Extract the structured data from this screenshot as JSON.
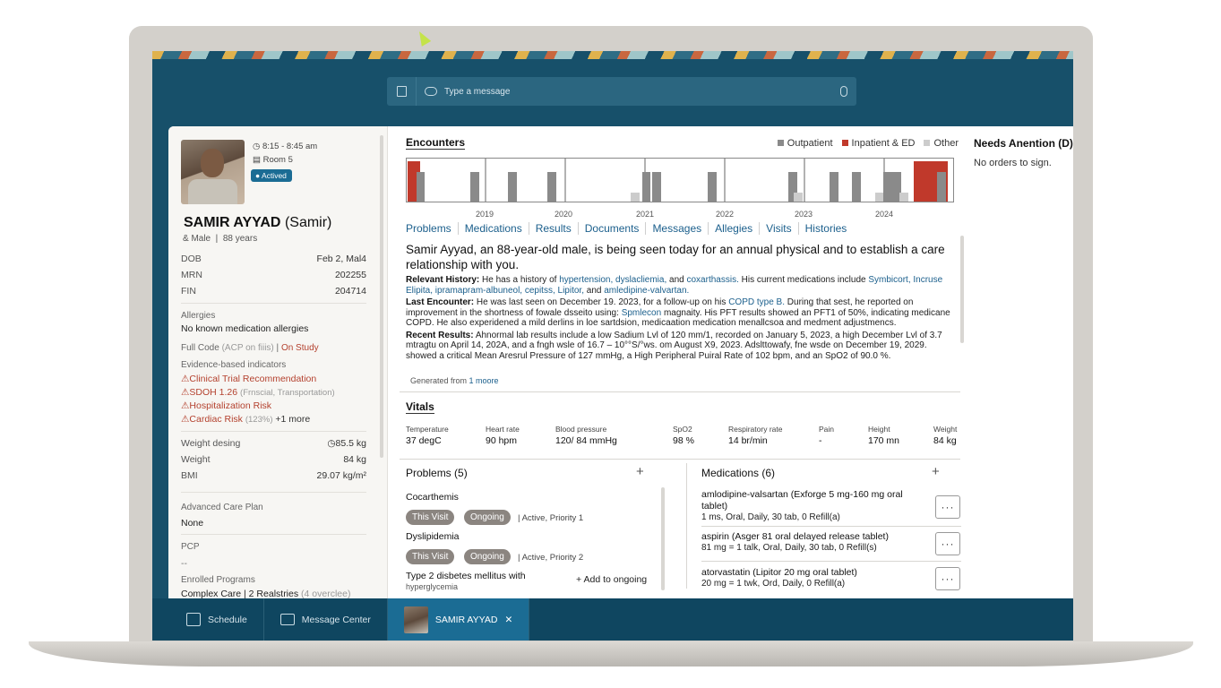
{
  "message_bar": {
    "placeholder": "Type a message"
  },
  "patient": {
    "time": "8:15 - 8:45 am",
    "room": "Room 5",
    "status": "Actived",
    "name": "SAMIR AYYAD",
    "nickname": "(Samir)",
    "sex": "& Male",
    "age": "88 years",
    "dob_label": "DOB",
    "dob": "Feb 2, Mal4",
    "mrn_label": "MRN",
    "mrn": "202255",
    "fin_label": "FIN",
    "fin": "204714",
    "allergies_label": "Allergies",
    "allergies": "No known medication allergies",
    "code_prefix": "Full Code",
    "code_acp": "(ACP on fiiis)",
    "code_sep": "|",
    "code_study": "On Study",
    "indicators_label": "Evidence-based indicators",
    "indicators": [
      {
        "label": "Clinical Trial Recommendation",
        "detail": ""
      },
      {
        "label": "SDOH 1.26",
        "detail": "(Frnscial, Transportation)"
      },
      {
        "label": "Hospitalization Risk",
        "detail": ""
      },
      {
        "label": "Cardiac Risk",
        "detail": "(123%)",
        "more": "+1 more"
      }
    ],
    "weight_dosing_label": "Weight desing",
    "weight_dosing": "85.5 kg",
    "weight_label": "Weight",
    "weight": "84 kg",
    "bmi_label": "BMI",
    "bmi": "29.07 kg/m²",
    "acp_label": "Advanced Care Plan",
    "acp": "None",
    "pcp_label": "PCP",
    "pcp": "--",
    "programs_label": "Enrolled Programs",
    "programs": "Complex Care | 2 Realstries",
    "programs_extra": "(4 overclee)"
  },
  "encounters": {
    "title": "Encounters",
    "legend": [
      {
        "label": "Outpatient",
        "color": "#8a8a8a"
      },
      {
        "label": "Inpatient & ED",
        "color": "#c0392b"
      },
      {
        "label": "Other",
        "color": "#cccccc"
      }
    ],
    "years": [
      "2019",
      "2020",
      "2021",
      "2022",
      "2023",
      "2024"
    ]
  },
  "tabs": [
    "Problems",
    "Medications",
    "Results",
    "Documents",
    "Messages",
    "Allegies",
    "Visits",
    "Histories"
  ],
  "summary": {
    "lead": "Samir Ayyad, an 88-year-old male, is being seen today for an annual physical and to establish a care relationship with you.",
    "history_label": "Relevant History:",
    "history_a": "He has a history of",
    "history_links": "hypertension, dyslacliemia,",
    "history_b": "and",
    "history_c": "coxarthassis.",
    "history_d": "His current medications include",
    "history_meds": "Symbicort, Incruse Elipita, ipramapram-albuneol, cepitss, Lipitor,",
    "history_e": "and",
    "history_f": "amledipine-valvartan.",
    "last_label": "Last Encounter:",
    "last_a": "He was last seen on December 19. 2023, for a follow-up on his",
    "last_link": "COPD type B.",
    "last_b": "During that sest, he reported on improvement in the shortness of fowale dsseito using:",
    "last_link2": "Spmlecon",
    "last_c": "magnaity. His PFT results showed an PFT1 of 50%, indicating medicane COPD. He also experidened a mild derlins in loe sartdsion, medicaation medication menallcsoa and medment adjustmencs.",
    "results_label": "Recent Results:",
    "results_text": "Ahnormal lab results include a low Sadium Lvl of 120 mm/1, recorded on January 5, 2023, a high December Lvl of 3.7 mtragtu on April 14, 202A, and a fngh wsle of 16.7 – 10°°S/°ws. om August X9, 2023. Adslttowafy, fne wsde on December 19, 2029. showed a critical Mean Aresrul Pressure of 127 mmHg, a High Peripheral Puiral Rate of 102 bpm, and an SpO2 of 90.0 %.",
    "generated_prefix": "Generated from",
    "generated_link": "1 moore"
  },
  "vitals": {
    "title": "Vitals",
    "items": [
      {
        "label": "Temperature",
        "value": "37 degC"
      },
      {
        "label": "Heart rate",
        "value": "90 hpm"
      },
      {
        "label": "Blood pressure",
        "value": "120/ 84 mmHg"
      },
      {
        "label": "SpO2",
        "value": "98 %"
      },
      {
        "label": "Respiratory rate",
        "value": "14 br/min"
      },
      {
        "label": "Pain",
        "value": "-"
      },
      {
        "label": "Height",
        "value": "170 mn"
      },
      {
        "label": "Weight",
        "value": "84 kg"
      }
    ]
  },
  "problems": {
    "title": "Problems (5)",
    "items": [
      {
        "name": "Cocarthemis",
        "chip1": "This Visit",
        "chip2": "Ongoing",
        "meta": "| Active, Priority 1"
      },
      {
        "name": "Dyslipidemia",
        "chip1": "This Visit",
        "chip2": "Ongoing",
        "meta": "| Active, Priority 2"
      },
      {
        "name": "Type 2 disbetes mellitus with",
        "name2": "hyperglycemia"
      }
    ],
    "add_label": "Add to ongoing"
  },
  "medications": {
    "title": "Medications (6)",
    "items": [
      {
        "name": "amlodipine-valsartan (Exforge 5 mg-160 mg oral tablet)",
        "detail": "1 ms, Oral, Daily, 30 tab, 0 Refill(a)"
      },
      {
        "name": "aspirin (Asger 81 oral delayed release tablet)",
        "detail": "81 mg = 1 talk, Oral, Daily, 30 tab, 0 Refill(s)"
      },
      {
        "name": "atorvastatin (Lipitor 20 mg oral tablet)",
        "detail": "20 mg = 1 twk, Ord, Daily, 0 Refill(a)"
      }
    ],
    "more_label": "···"
  },
  "attention": {
    "title": "Needs Anention (D)",
    "text": "No orders to sign."
  },
  "bottom_bar": {
    "schedule": "Schedule",
    "message_center": "Message Center",
    "patient_tab": "SAMIR AYYAD",
    "close": "✕"
  }
}
